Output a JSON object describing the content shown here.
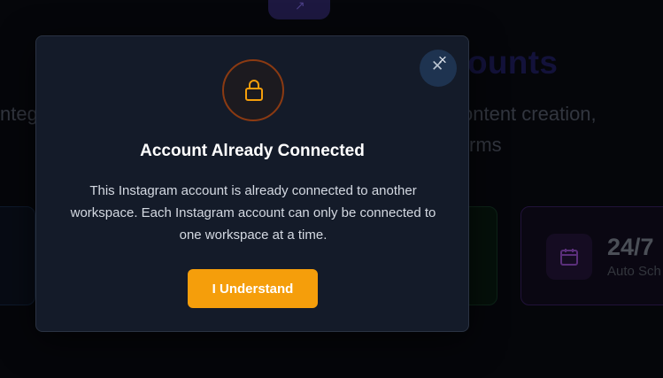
{
  "background": {
    "pill_icon": "arrow-icon",
    "heading_partial": "ounts",
    "subtitle_left_partial": "nteg",
    "subtitle_right_line1": "ontent creation,",
    "subtitle_right_line2": "rms",
    "stat_card": {
      "icon": "calendar-icon",
      "value": "24/7",
      "label": "Auto Sch"
    }
  },
  "modal": {
    "icon": "lock-icon",
    "title": "Account Already Connected",
    "message": "This Instagram account is already connected to another workspace. Each Instagram account can only be connected to one workspace at a time.",
    "confirm_label": "I Understand",
    "close_icon": "close-icon"
  },
  "colors": {
    "accent": "#f59e0b",
    "modal_bg": "#141b29",
    "page_bg": "#05060a"
  }
}
